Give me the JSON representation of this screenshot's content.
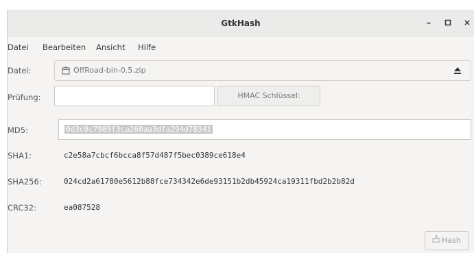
{
  "window": {
    "title": "GtkHash",
    "controls": {
      "minimize": "–",
      "maximize": "▫",
      "close": "×"
    }
  },
  "menu": {
    "items": [
      "Datei",
      "Bearbeiten",
      "Ansicht",
      "Hilfe"
    ]
  },
  "file": {
    "label": "Datei:",
    "value": "OffRoad-bin-0.5.zip"
  },
  "verify": {
    "label": "Prüfung:",
    "value": "",
    "hmac_label": "HMAC Schlüssel:"
  },
  "hashes": [
    {
      "label": "MD5:",
      "value": "0d3c0c7989f3ca260aa3dfa294d78341"
    },
    {
      "label": "SHA1:",
      "value": "c2e58a7cbcf6bcca8f57d487f5bec0389ce618e4"
    },
    {
      "label": "SHA256:",
      "value": "024cd2a61780e5612b88fce734342e6de93151b2db45924ca19311fbd2b2b82d"
    },
    {
      "label": "CRC32:",
      "value": "ea087528"
    }
  ],
  "actions": {
    "hash_label": "Hash"
  },
  "colors": {
    "titlebar": "#ebebea",
    "window_bg": "#f5f4f3",
    "selection_bg": "#c9c9c9"
  }
}
